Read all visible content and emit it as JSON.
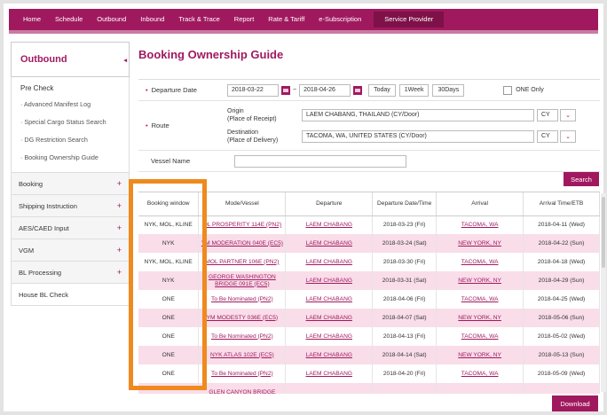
{
  "nav": {
    "items": [
      "Home",
      "Schedule",
      "Outbound",
      "Inbound",
      "Track & Trace",
      "Report",
      "Rate & Tariff",
      "e-Subscription"
    ],
    "active": "Service Provider"
  },
  "sidebar": {
    "title": "Outbound",
    "precheck": {
      "title": "Pre Check",
      "subitems": [
        "· Advanced Manifest Log",
        "· Special Cargo Status Search",
        "· DG Restriction Search",
        "· Booking Ownership Guide"
      ]
    },
    "items": [
      {
        "label": "Booking",
        "plus": "+"
      },
      {
        "label": "Shipping Instruction",
        "plus": "+"
      },
      {
        "label": "AES/CAED Input",
        "plus": "+"
      },
      {
        "label": "VGM",
        "plus": "+"
      },
      {
        "label": "BL Processing",
        "plus": "+"
      },
      {
        "label": "House BL Check",
        "plus": ""
      }
    ]
  },
  "page": {
    "title": "Booking Ownership Guide"
  },
  "form": {
    "required_mark": "•",
    "departure_date_label": "Departure Date",
    "date_from": "2018-03-22",
    "date_sep": "~",
    "date_to": "2018-04-26",
    "btn_today": "Today",
    "btn_week": "1Week",
    "btn_30days": "30Days",
    "one_only_label": "ONE Only",
    "route_label": "Route",
    "origin_label_1": "Origin",
    "origin_label_2": "(Place of Receipt)",
    "origin_value": "LAEM CHABANG, THAILAND (CY/Door)",
    "origin_type": "CY",
    "dest_label_1": "Destination",
    "dest_label_2": "(Place of Delivery)",
    "dest_value": "TACOMA, WA, UNITED STATES (CY/Door)",
    "dest_type": "CY",
    "vessel_label": "Vessel Name",
    "vessel_value": ""
  },
  "buttons": {
    "search": "Search",
    "download": "Download"
  },
  "table": {
    "headers": [
      "Booking window",
      "Mode/Vessel",
      "Departure",
      "Departure Date/Time",
      "Arrival",
      "Arrival Time/ETB"
    ],
    "rows": [
      {
        "window": "NYK, MOL, KLINE",
        "vessel": "OL PROSPERITY 114E (PN2)",
        "departure": "LAEM CHABANG",
        "dep_time": "2018-03-23 (Fri)",
        "arrival": "TACOMA, WA",
        "arr_time": "2018-04-11 (Wed)"
      },
      {
        "window": "NYK",
        "vessel": "YM MODERATION 040E (EC5)",
        "departure": "LAEM CHABANG",
        "dep_time": "2018-03-24 (Sat)",
        "arrival": "NEW YORK, NY",
        "arr_time": "2018-04-22 (Sun)"
      },
      {
        "window": "NYK, MOL, KLINE",
        "vessel": "MOL PARTNER 106E (PN2)",
        "departure": "LAEM CHABANG",
        "dep_time": "2018-03-30 (Fri)",
        "arrival": "TACOMA, WA",
        "arr_time": "2018-04-18 (Wed)"
      },
      {
        "window": "NYK",
        "vessel": "GEORGE WASHINGTON BRIDGE 091E (EC5)",
        "departure": "LAEM CHABANG",
        "dep_time": "2018-03-31 (Sat)",
        "arrival": "NEW YORK, NY",
        "arr_time": "2018-04-29 (Sun)"
      },
      {
        "window": "ONE",
        "vessel": "To Be Nominated (PN2)",
        "departure": "LAEM CHABANG",
        "dep_time": "2018-04-06 (Fri)",
        "arrival": "TACOMA, WA",
        "arr_time": "2018-04-25 (Wed)"
      },
      {
        "window": "ONE",
        "vessel": "YM MODESTY 036E (EC5)",
        "departure": "LAEM CHABANG",
        "dep_time": "2018-04-07 (Sat)",
        "arrival": "NEW YORK, NY",
        "arr_time": "2018-05-06 (Sun)"
      },
      {
        "window": "ONE",
        "vessel": "To Be Nominated (PN2)",
        "departure": "LAEM CHABANG",
        "dep_time": "2018-04-13 (Fri)",
        "arrival": "TACOMA, WA",
        "arr_time": "2018-05-02 (Wed)"
      },
      {
        "window": "ONE",
        "vessel": "NYK ATLAS 102E (EC5)",
        "departure": "LAEM CHABANG",
        "dep_time": "2018-04-14 (Sat)",
        "arrival": "NEW YORK, NY",
        "arr_time": "2018-05-13 (Sun)"
      },
      {
        "window": "ONE",
        "vessel": "To Be Nominated (PN2)",
        "departure": "LAEM CHABANG",
        "dep_time": "2018-04-20 (Fri)",
        "arrival": "TACOMA, WA",
        "arr_time": "2018-05-09 (Wed)"
      },
      {
        "window": "",
        "vessel": "GLEN CANYON BRIDGE",
        "departure": "",
        "dep_time": "",
        "arrival": "",
        "arr_time": ""
      }
    ]
  },
  "colors": {
    "brand": "#a0195f",
    "row_alt": "#f9dde9",
    "highlight": "#ee8a1e"
  }
}
